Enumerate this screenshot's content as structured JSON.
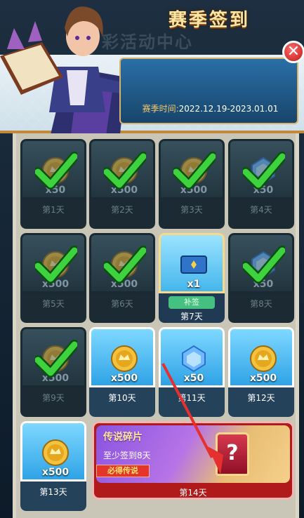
{
  "background": {
    "title": "彩活动中心"
  },
  "header": {
    "title": "赛季签到",
    "date_label": "赛季时间:",
    "date_range": "2022.12.19-2023.01.01",
    "close_label": "✕"
  },
  "days": [
    {
      "day": "第1天",
      "qty": "x50",
      "item": "coin",
      "state": "claimed"
    },
    {
      "day": "第2天",
      "qty": "x500",
      "item": "coin",
      "state": "claimed"
    },
    {
      "day": "第3天",
      "qty": "x500",
      "item": "coin",
      "state": "claimed"
    },
    {
      "day": "第4天",
      "qty": "x50",
      "item": "gem",
      "state": "claimed"
    },
    {
      "day": "第5天",
      "qty": "x500",
      "item": "coin",
      "state": "claimed"
    },
    {
      "day": "第6天",
      "qty": "x500",
      "item": "coin",
      "state": "claimed"
    },
    {
      "day": "第7天",
      "qty": "x1",
      "item": "card",
      "state": "today",
      "badge": "补签"
    },
    {
      "day": "第8天",
      "qty": "x50",
      "item": "gem",
      "state": "claimed"
    },
    {
      "day": "第9天",
      "qty": "x500",
      "item": "coin",
      "state": "claimed"
    },
    {
      "day": "第10天",
      "qty": "x500",
      "item": "coin",
      "state": "available"
    },
    {
      "day": "第11天",
      "qty": "x50",
      "item": "gem",
      "state": "available"
    },
    {
      "day": "第12天",
      "qty": "x500",
      "item": "coin",
      "state": "available"
    },
    {
      "day": "第13天",
      "qty": "x500",
      "item": "coin",
      "state": "available"
    }
  ],
  "grand_prize": {
    "title": "传说碎片",
    "requirement": "至少签到8天",
    "tag": "必得传说",
    "symbol": "?",
    "day": "第14天"
  },
  "colors": {
    "accent": "#c08a3a",
    "available": "#2ea3e6",
    "claimed": "#22353f",
    "check": "#3ed33e"
  }
}
